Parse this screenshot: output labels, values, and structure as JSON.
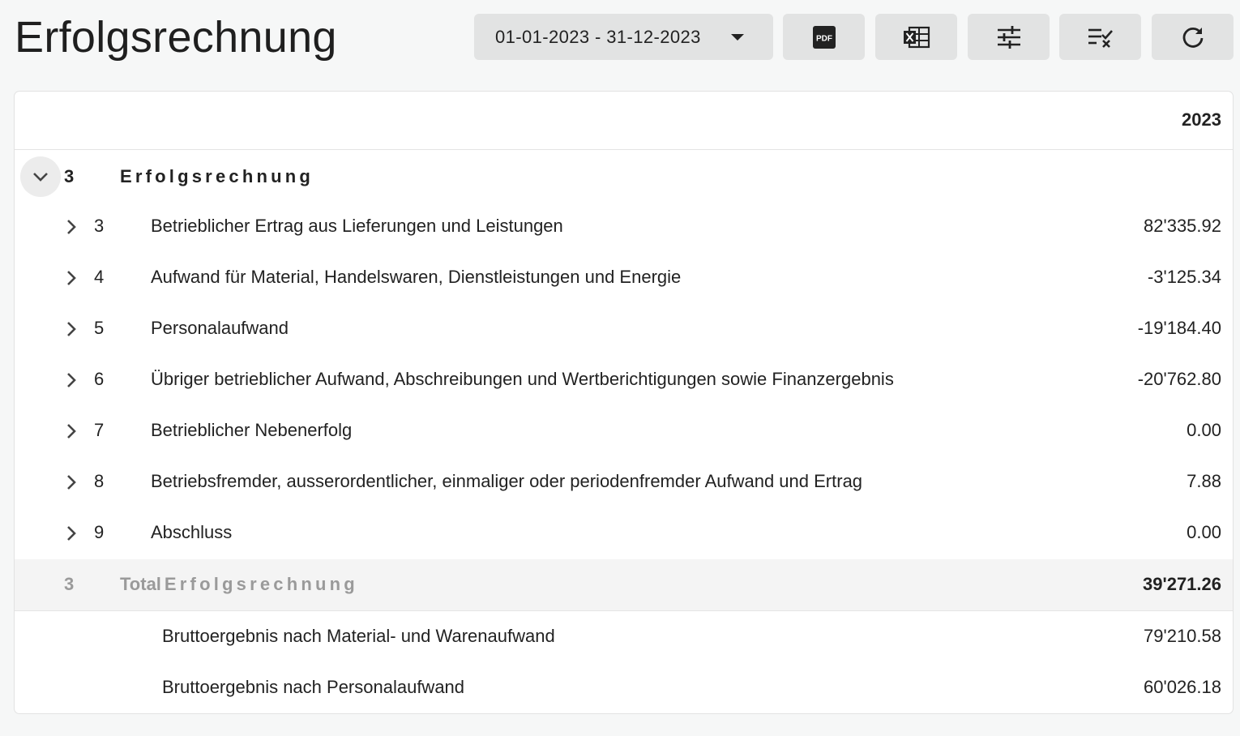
{
  "page": {
    "title": "Erfolgsrechnung"
  },
  "toolbar": {
    "date_range": "01-01-2023 - 31-12-2023",
    "buttons": [
      {
        "name": "pdf-export",
        "icon": "pdf-icon"
      },
      {
        "name": "excel-export",
        "icon": "excel-icon"
      },
      {
        "name": "settings",
        "icon": "sliders-icon"
      },
      {
        "name": "select-columns",
        "icon": "checklist-icon"
      },
      {
        "name": "refresh",
        "icon": "refresh-icon"
      }
    ]
  },
  "table": {
    "column_header": "2023",
    "group": {
      "number": "3",
      "label": "Erfolgsrechnung"
    },
    "rows": [
      {
        "number": "3",
        "label": "Betrieblicher Ertrag aus Lieferungen und Leistungen",
        "value": "82'335.92"
      },
      {
        "number": "4",
        "label": "Aufwand für Material, Handelswaren, Dienstleistungen und Energie",
        "value": "-3'125.34"
      },
      {
        "number": "5",
        "label": "Personalaufwand",
        "value": "-19'184.40"
      },
      {
        "number": "6",
        "label": "Übriger betrieblicher Aufwand, Abschreibungen und Wertberichtigungen sowie Finanzergebnis",
        "value": "-20'762.80"
      },
      {
        "number": "7",
        "label": "Betrieblicher Nebenerfolg",
        "value": "0.00"
      },
      {
        "number": "8",
        "label": "Betriebsfremder, ausserordentlicher, einmaliger oder periodenfremder Aufwand und Ertrag",
        "value": "7.88"
      },
      {
        "number": "9",
        "label": "Abschluss",
        "value": "0.00"
      }
    ],
    "total": {
      "number": "3",
      "prefix": "Total",
      "label": "Erfolgsrechnung",
      "value": "39'271.26"
    },
    "summary": [
      {
        "label": "Bruttoergebnis nach Material- und Warenaufwand",
        "value": "79'210.58"
      },
      {
        "label": "Bruttoergebnis nach Personalaufwand",
        "value": "60'026.18"
      }
    ]
  },
  "colors": {
    "background": "#f6f7f7",
    "button_bg": "#e2e3e3",
    "total_row_bg": "#f4f4f4",
    "muted_text": "#9a9a9a"
  }
}
